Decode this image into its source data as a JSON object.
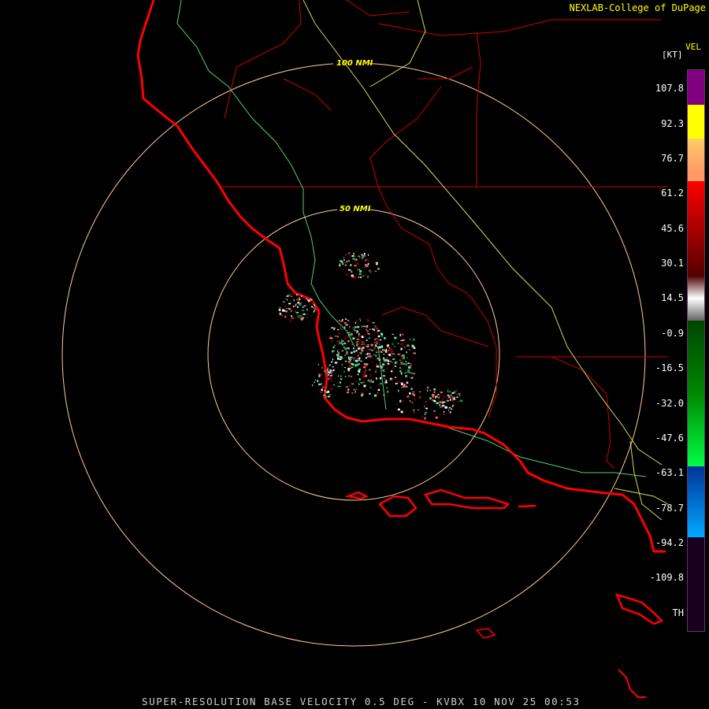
{
  "credit": "NEXLAB-College of DuPage",
  "footer": "SUPER-RESOLUTION BASE VELOCITY 0.5 DEG - KVBX 10 NOV 25 00:53",
  "legend": {
    "title": "VEL",
    "unit": "[KT]",
    "ticks": [
      "107.8",
      "92.3",
      "76.7",
      "61.2",
      "45.6",
      "30.1",
      "14.5",
      "-0.9",
      "-16.5",
      "-32.0",
      "-47.6",
      "-63.1",
      "-78.7",
      "-94.2",
      "-109.8",
      "TH"
    ],
    "colors": [
      "#800080",
      "#ffff00",
      "#ff9966",
      "#ff0000",
      "#cc0000",
      "#990000",
      "#660000",
      "#bfbfbf",
      "#00aa00",
      "#00ff44",
      "#0066cc",
      "#00aaff",
      "#1a0020"
    ]
  },
  "rings": [
    "100 NMI",
    "50 NMI"
  ],
  "map": {
    "coast_color": "#ff0000",
    "county_color": "#cc0000",
    "highway_color": "#ffff66",
    "river_color": "#66ff99",
    "ring_color": "#ffcc99"
  }
}
